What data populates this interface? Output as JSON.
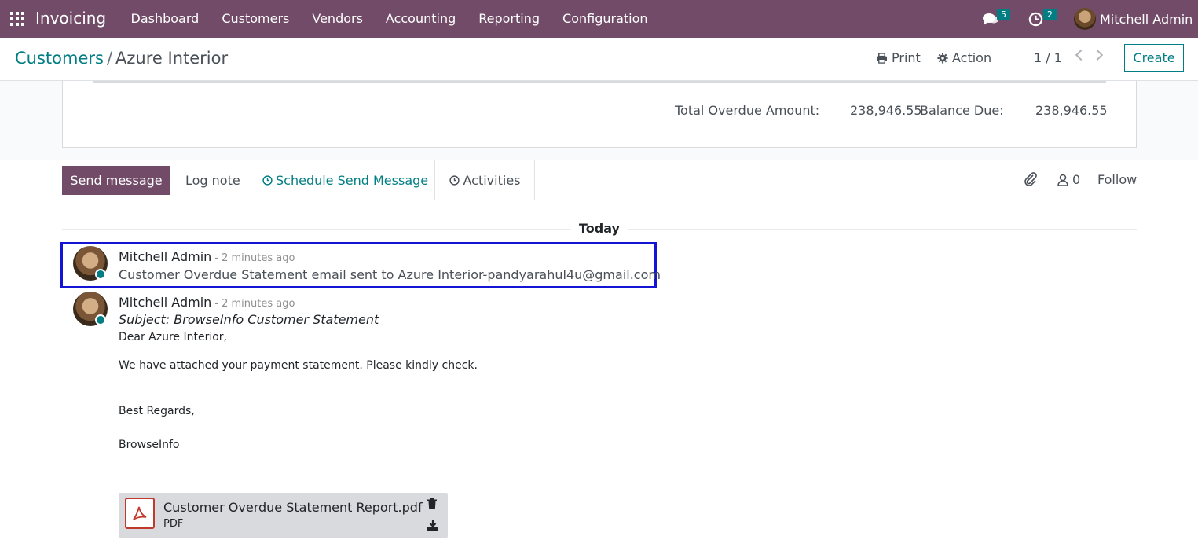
{
  "navbar": {
    "brand": "Invoicing",
    "menu": [
      "Dashboard",
      "Customers",
      "Vendors",
      "Accounting",
      "Reporting",
      "Configuration"
    ],
    "messages_count": "5",
    "activities_count": "2",
    "user": "Mitchell Admin"
  },
  "control_panel": {
    "breadcrumb_parent": "Customers",
    "breadcrumb_separator": "/",
    "breadcrumb_current": "Azure Interior",
    "print_label": "Print",
    "action_label": "Action",
    "pager": "1 / 1",
    "create_label": "Create"
  },
  "totals": {
    "overdue_label": "Total Overdue Amount:",
    "overdue_value": "238,946.55",
    "balance_label": "Balance Due:",
    "balance_value": "238,946.55"
  },
  "chatter": {
    "send_message": "Send message",
    "log_note": "Log note",
    "schedule": "Schedule Send Message",
    "activities": "Activities",
    "followers_count": "0",
    "follow": "Follow",
    "today": "Today"
  },
  "messages": [
    {
      "author": "Mitchell Admin",
      "date": "- 2 minutes ago",
      "body": "Customer Overdue Statement email sent to Azure Interior-pandyarahul4u@gmail.com"
    },
    {
      "author": "Mitchell Admin",
      "date": "- 2 minutes ago",
      "subject": "Subject: BrowseInfo Customer Statement",
      "greeting": "Dear Azure Interior,",
      "line1": "We have attached your payment statement. Please kindly check.",
      "regards": "Best Regards,",
      "signature": "BrowseInfo",
      "attachment_name": "Customer Overdue Statement Report.pdf",
      "attachment_type": "PDF"
    }
  ],
  "colors": {
    "brand": "#714b67",
    "accent": "#017e84",
    "highlight": "#1414d4"
  }
}
